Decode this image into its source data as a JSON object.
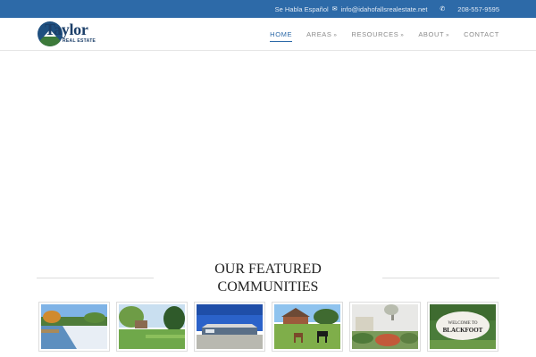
{
  "topbar": {
    "language_text": "Se Habla Español",
    "email": "info@idahofallsrealestate.net",
    "phone": "208-557-9595",
    "mail_icon": "mail-icon",
    "phone_icon": "phone-icon"
  },
  "logo": {
    "name": "Taylor",
    "tagline": "REAL ESTATE"
  },
  "nav": {
    "items": [
      {
        "label": "HOME",
        "active": true
      },
      {
        "label": "AREAS",
        "dropdown": true
      },
      {
        "label": "RESOURCES",
        "dropdown": true
      },
      {
        "label": "ABOUT",
        "dropdown": true
      },
      {
        "label": "CONTACT"
      }
    ],
    "dropdown_glyph": "»"
  },
  "featured": {
    "title_line1": "OUR FEATURED",
    "title_line2": "COMMUNITIES",
    "sign_text_1": "WELCOME TO",
    "sign_text_2": "BLACKFOOT"
  },
  "colors": {
    "topbar_bg": "#2d6aa8",
    "accent": "#2d6aa8",
    "logo_text": "#1c3f69"
  }
}
